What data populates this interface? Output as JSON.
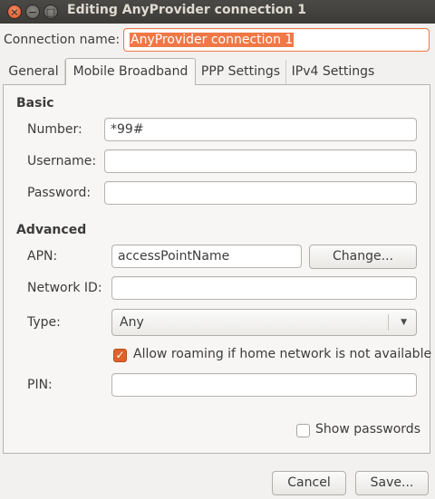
{
  "window": {
    "title": "Editing AnyProvider connection 1",
    "close_glyph": "×",
    "minimize_glyph": "−",
    "maximize_glyph": "□"
  },
  "connection_name": {
    "label": "Connection name:",
    "value": "AnyProvider connection 1"
  },
  "tabs": [
    {
      "label": "General"
    },
    {
      "label": "Mobile Broadband"
    },
    {
      "label": "PPP Settings"
    },
    {
      "label": "IPv4 Settings"
    }
  ],
  "active_tab": "Mobile Broadband",
  "basic": {
    "heading": "Basic",
    "number_label": "Number:",
    "number_value": "*99#",
    "username_label": "Username:",
    "username_value": "",
    "password_label": "Password:",
    "password_value": ""
  },
  "advanced": {
    "heading": "Advanced",
    "apn_label": "APN:",
    "apn_value": "accessPointName",
    "change_button": "Change...",
    "network_id_label": "Network ID:",
    "network_id_value": "",
    "type_label": "Type:",
    "type_value": "Any",
    "type_arrow": "▼",
    "roaming_label": "Allow roaming if home network is not available",
    "roaming_checked": true,
    "roaming_check_glyph": "✓",
    "pin_label": "PIN:",
    "pin_value": ""
  },
  "show_passwords": {
    "label": "Show passwords",
    "checked": false
  },
  "footer": {
    "cancel_button": "Cancel",
    "save_button": "Save..."
  },
  "colors": {
    "accent": "#f07746",
    "checkbox_checked": "#e0612a",
    "titlebar": "#3c3b37",
    "close_button": "#e0501f"
  },
  "icons": {
    "close": "close-icon",
    "minimize": "minimize-icon",
    "maximize": "maximize-icon",
    "dropdown": "chevron-down-icon",
    "checkmark": "checkmark-icon"
  }
}
